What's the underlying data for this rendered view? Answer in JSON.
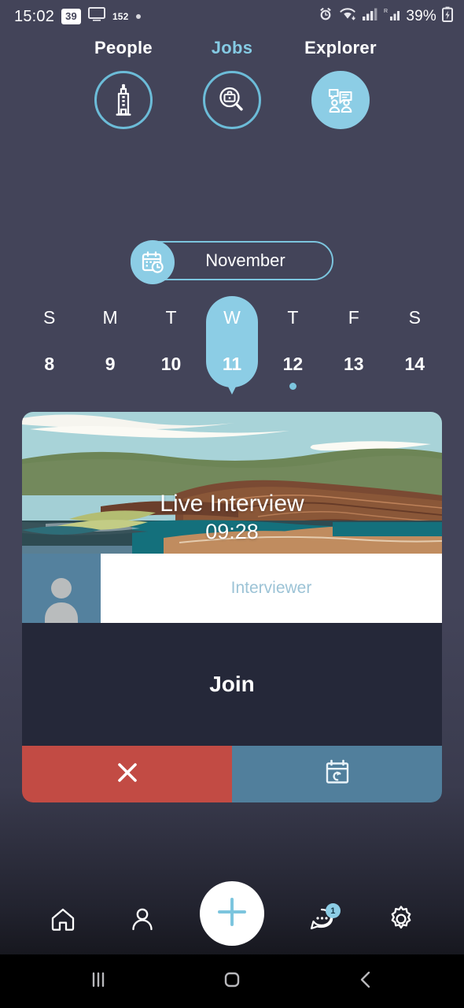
{
  "status_bar": {
    "time": "15:02",
    "notification_badge": "39",
    "monitor_icon": "monitor-icon",
    "notification_count": "152",
    "dot_icon": "dot-icon",
    "alarm_icon": "alarm-icon",
    "wifi_icon": "wifi-icon",
    "signal_icon": "signal-bars-icon",
    "roaming_icon": "roaming-signal-icon",
    "battery_percent": "39%",
    "battery_icon": "battery-charging-icon"
  },
  "top_nav": {
    "items": [
      {
        "label": "People",
        "icon": "building-icon",
        "active": false
      },
      {
        "label": "Jobs",
        "icon": "briefcase-search-icon",
        "active": true
      },
      {
        "label": "Explorer",
        "icon": "people-chat-icon",
        "active": false
      }
    ]
  },
  "month_selector": {
    "icon": "calendar-clock-icon",
    "month": "November"
  },
  "week_strip": {
    "days": [
      {
        "dow": "S",
        "date": "8",
        "selected": false,
        "has_event": false
      },
      {
        "dow": "M",
        "date": "9",
        "selected": false,
        "has_event": false
      },
      {
        "dow": "T",
        "date": "10",
        "selected": false,
        "has_event": false
      },
      {
        "dow": "W",
        "date": "11",
        "selected": true,
        "has_event": false
      },
      {
        "dow": "T",
        "date": "12",
        "selected": false,
        "has_event": true
      },
      {
        "dow": "F",
        "date": "13",
        "selected": false,
        "has_event": false
      },
      {
        "dow": "S",
        "date": "14",
        "selected": false,
        "has_event": false
      }
    ]
  },
  "event_card": {
    "title": "Live Interview",
    "time": "09:28",
    "avatar_icon": "person-avatar-icon",
    "interviewer_label": "Interviewer",
    "join_label": "Join",
    "cancel_icon": "close-x-icon",
    "reschedule_icon": "calendar-reschedule-icon"
  },
  "bottom_nav": {
    "items": [
      {
        "name": "home",
        "icon": "home-icon"
      },
      {
        "name": "profile",
        "icon": "person-icon"
      },
      {
        "name": "add",
        "icon": "plus-icon"
      },
      {
        "name": "messages",
        "icon": "chat-bubble-icon",
        "badge": "1"
      },
      {
        "name": "settings",
        "icon": "gear-icon"
      }
    ]
  },
  "system_nav": {
    "recents_icon": "recents-icon",
    "home_icon": "home-square-icon",
    "back_icon": "back-chevron-icon"
  },
  "colors": {
    "accent": "#8ccde5",
    "background": "#434459",
    "card_dark": "#252839",
    "cancel_red": "#c24b44",
    "reschedule_blue": "#517f9c"
  }
}
